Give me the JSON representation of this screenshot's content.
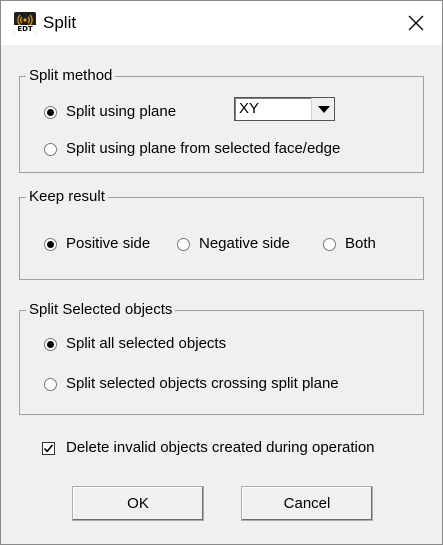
{
  "window": {
    "title": "Split",
    "icon_text": "EDT"
  },
  "split_method": {
    "legend": "Split method",
    "options": [
      {
        "label": "Split using plane",
        "selected": true
      },
      {
        "label": "Split using plane from selected face/edge",
        "selected": false
      }
    ],
    "plane_combo": {
      "value": "XY"
    }
  },
  "keep_result": {
    "legend": "Keep result",
    "options": [
      {
        "label": "Positive side",
        "selected": true
      },
      {
        "label": "Negative side",
        "selected": false
      },
      {
        "label": "Both",
        "selected": false
      }
    ]
  },
  "split_selected": {
    "legend": "Split Selected objects",
    "options": [
      {
        "label": "Split all selected objects",
        "selected": true
      },
      {
        "label": "Split selected objects crossing split plane",
        "selected": false
      }
    ]
  },
  "delete_invalid": {
    "label": "Delete invalid objects created during operation",
    "checked": true
  },
  "buttons": {
    "ok": "OK",
    "cancel": "Cancel"
  }
}
